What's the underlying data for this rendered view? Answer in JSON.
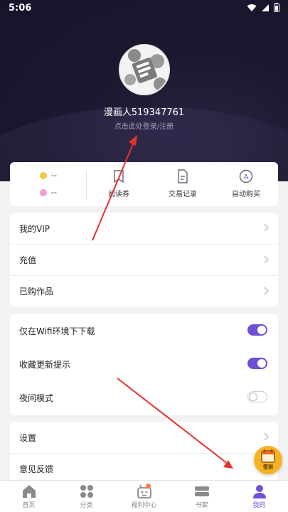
{
  "status_bar": {
    "time": "5:06",
    "icons": [
      "wifi-icon",
      "signal-icon",
      "battery-icon"
    ]
  },
  "profile": {
    "username": "漫画人519347761",
    "login_hint": "点击此处登录/注册"
  },
  "wallet": {
    "coin1": {
      "value": "--",
      "color": "#f5c842"
    },
    "coin2": {
      "value": "--",
      "color": "#f29ad0"
    },
    "items": [
      {
        "label": "阅读券",
        "icon": "ticket-icon"
      },
      {
        "label": "交易记录",
        "icon": "document-icon"
      },
      {
        "label": "自动购买",
        "icon": "auto-buy-icon"
      }
    ]
  },
  "menu1": [
    {
      "label": "我的VIP"
    },
    {
      "label": "充值"
    },
    {
      "label": "已购作品"
    }
  ],
  "menu2": [
    {
      "label": "仅在Wifi环境下下载",
      "on": true
    },
    {
      "label": "收藏更新提示",
      "on": true
    },
    {
      "label": "夜间模式",
      "on": false
    }
  ],
  "menu3": [
    {
      "label": "设置"
    },
    {
      "label": "意见反馈"
    }
  ],
  "signin": {
    "label": "签到"
  },
  "tabs": [
    {
      "label": "首页",
      "icon": "home-icon"
    },
    {
      "label": "分类",
      "icon": "grid-icon"
    },
    {
      "label": "福利中心",
      "icon": "gift-icon"
    },
    {
      "label": "书架",
      "icon": "bookshelf-icon"
    },
    {
      "label": "我的",
      "icon": "person-icon"
    }
  ],
  "active_tab": "我的",
  "colors": {
    "accent": "#6f4fd8",
    "hero_bg": "#1d1830",
    "annotation": "#e8312a"
  }
}
